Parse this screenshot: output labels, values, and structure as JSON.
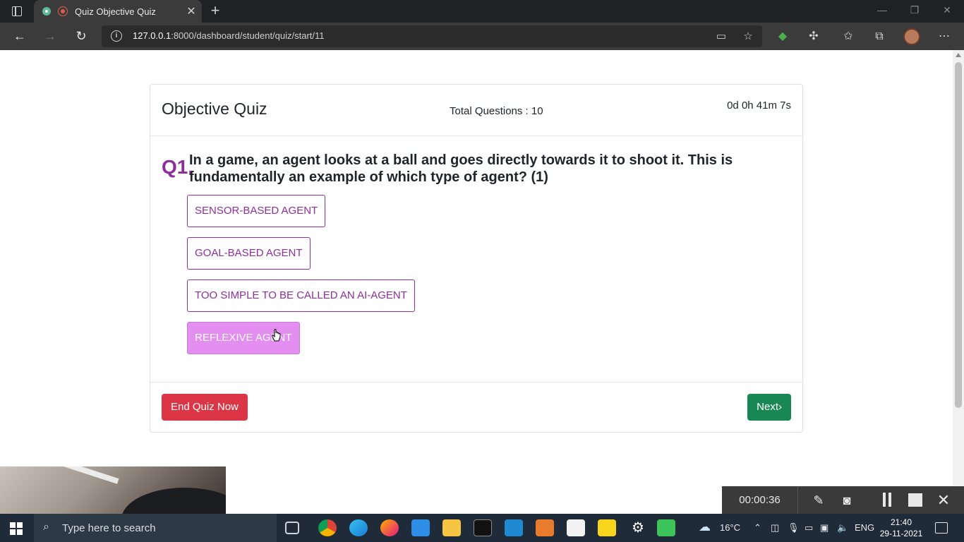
{
  "browser": {
    "tab_title": "Quiz Objective Quiz",
    "tab_close": "✕",
    "new_tab": "+",
    "url_host": "127.0.0.1",
    "url_rest": ":8000/dashboard/student/quiz/start/11",
    "window_controls": [
      "—",
      "❐",
      "✕"
    ],
    "nav": {
      "back": "←",
      "forward": "→",
      "reload": "↻"
    },
    "icons": [
      "info-icon",
      "camera-icon",
      "favorite-add-icon",
      "extension-shield-icon",
      "extensions-icon",
      "favorites-icon",
      "collections-icon",
      "profile-avatar",
      "more-icon"
    ]
  },
  "quiz": {
    "title": "Objective Quiz",
    "total_questions": "Total Questions : 10",
    "timer": "0d 0h 41m 7s",
    "question_number": "Q1.",
    "question_text": "In a game, an agent looks at a ball and goes directly towards it to shoot it. This is fundamentally an example of which type of agent? (1)",
    "options": [
      {
        "label": "SENSOR-BASED AGENT",
        "selected": false
      },
      {
        "label": "GOAL-BASED AGENT",
        "selected": false
      },
      {
        "label": "TOO SIMPLE TO BE CALLED AN AI-AGENT",
        "selected": false
      },
      {
        "label": "REFLEXIVE AGENT",
        "selected": true
      }
    ],
    "end_button": "End Quiz Now",
    "next_button": "Next›",
    "colors": {
      "accent": "#8e2e9a",
      "selected_bg": "#e38ef0",
      "danger": "#dc3545",
      "success": "#198754"
    }
  },
  "recorder": {
    "elapsed": "00:00:36",
    "icons": [
      "pen-icon",
      "camera-icon",
      "pause-icon",
      "stop-icon",
      "close-icon"
    ]
  },
  "taskbar": {
    "search_placeholder": "Type here to search",
    "weather": "16°C",
    "language": "ENG",
    "time": "21:40",
    "date": "29-11-2021",
    "apps": [
      "task-view-icon",
      "chrome-icon",
      "edge-icon",
      "firefox-icon",
      "ubuntu-icon",
      "file-explorer-icon",
      "terminal-icon",
      "vscode-icon",
      "git-icon",
      "store-icon",
      "sticky-notes-icon",
      "settings-icon",
      "screen-recorder-icon"
    ]
  }
}
